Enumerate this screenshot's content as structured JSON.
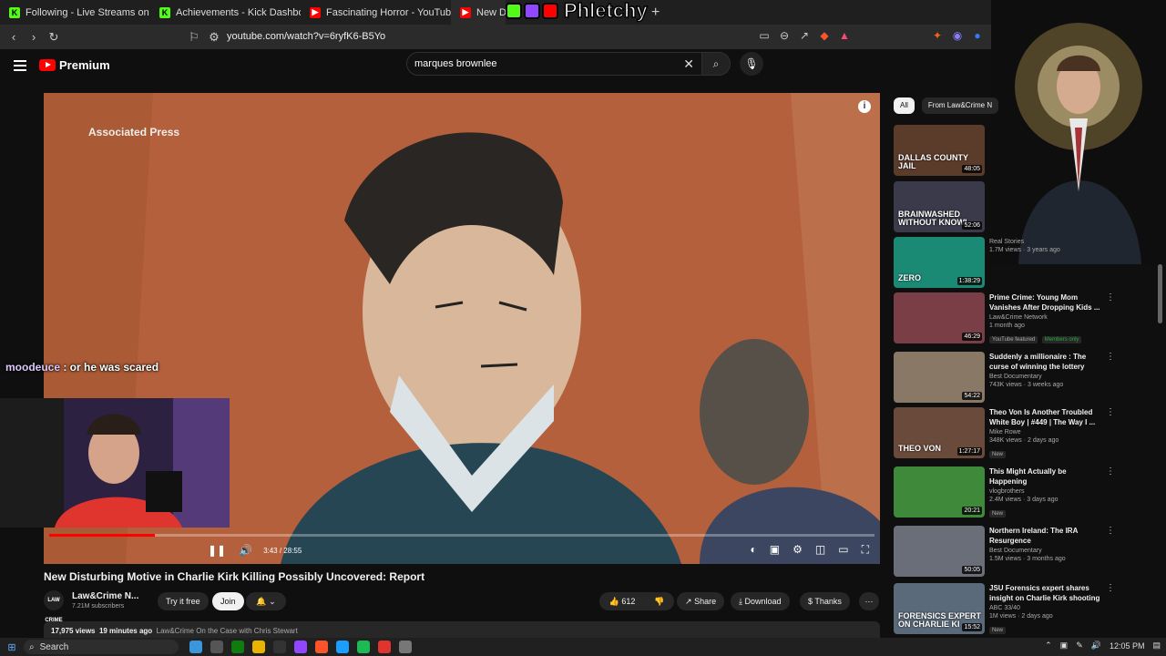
{
  "browser": {
    "tabs": [
      {
        "label": "Following - Live Streams on Kick",
        "favicon": "kick-icon"
      },
      {
        "label": "Achievements - Kick Dashboard",
        "favicon": "kick-icon"
      },
      {
        "label": "Fascinating Horror - YouTube",
        "favicon": "youtube-icon"
      },
      {
        "label": "New Di",
        "favicon": "youtube-icon"
      }
    ],
    "url": "youtube.com/watch?v=6ryfK6-B5Yo",
    "overlay_text": "Phletchy"
  },
  "youtube": {
    "logo_text": "Premium",
    "search_value": "marques brownlee"
  },
  "video": {
    "watermark": "Associated Press",
    "time": "3:43 / 28:55",
    "progress": 0.128,
    "title": "New Disturbing Motive in Charlie Kirk Killing Possibly Uncovered: Report",
    "channel_avatar": "LAW CRIME",
    "channel_name": "Law&Crime N...",
    "subscribers": "7.21M subscribers",
    "try_free_label": "Try it free",
    "join_label": "Join",
    "likes": "612",
    "share_label": "Share",
    "download_label": "Download",
    "thanks_label": "Thanks",
    "views": "17,975 views",
    "age": "19 minutes ago",
    "desc_channel": "Law&Crime On the Case with Chris Stewart"
  },
  "chat": {
    "user": "moodeuce",
    "message": " : or he was scared"
  },
  "sidebar": {
    "chips": [
      "All",
      "From Law&Crime N"
    ],
    "items": [
      {
        "title": "",
        "channel": "",
        "stats": "",
        "duration": "48:05",
        "thumb_text": "DALLAS COUNTY JAIL",
        "thumb_color": "#5b3b2a"
      },
      {
        "title": "",
        "channel": "",
        "stats": "",
        "duration": "52:06",
        "thumb_text": "BRAINWASHED WITHOUT KNOWI",
        "thumb_color": "#3a3a4a"
      },
      {
        "title": "",
        "channel": "Real Stories",
        "stats": "1.7M views · 3 years ago",
        "duration": "1:38:29",
        "thumb_text": "ZERO",
        "thumb_color": "#1b8a74"
      },
      {
        "title": "Prime Crime: Young Mom Vanishes After Dropping Kids ...",
        "channel": "Law&Crime Network",
        "stats": "1 month ago",
        "duration": "46:29",
        "thumb_text": "",
        "thumb_color": "#7a3e46",
        "badges": [
          "YouTube featured",
          "Members only"
        ]
      },
      {
        "title": "Suddenly a millionaire : The curse of winning the lottery",
        "channel": "Best Documentary",
        "stats": "743K views · 3 weeks ago",
        "duration": "54:22",
        "thumb_text": "",
        "thumb_color": "#8a7866"
      },
      {
        "title": "Theo Von Is Another Troubled White Boy | #449 | The Way I ...",
        "channel": "Mike Rowe",
        "stats": "348K views · 2 days ago",
        "duration": "1:27:17",
        "thumb_text": "THEO VON",
        "thumb_color": "#6a4a3a",
        "badges": [
          "New"
        ]
      },
      {
        "title": "This Might Actually be Happening",
        "channel": "vlogbrothers",
        "stats": "2.4M views · 3 days ago",
        "duration": "20:21",
        "thumb_text": "",
        "thumb_color": "#3e8a3a",
        "badges": [
          "New"
        ]
      },
      {
        "title": "Northern Ireland: The IRA Resurgence",
        "channel": "Best Documentary",
        "stats": "1.5M views · 3 months ago",
        "duration": "50:05",
        "thumb_text": "",
        "thumb_color": "#6a6e78"
      },
      {
        "title": "JSU Forensics expert shares insight on Charlie Kirk shooting",
        "channel": "ABC 33/40",
        "stats": "1M views · 2 days ago",
        "duration": "15:52",
        "thumb_text": "FORENSICS EXPERT ON CHARLIE KI",
        "thumb_color": "#5a6a7a",
        "badges": [
          "New"
        ]
      }
    ]
  },
  "taskbar": {
    "search_label": "Search",
    "time": "12:05 PM"
  }
}
